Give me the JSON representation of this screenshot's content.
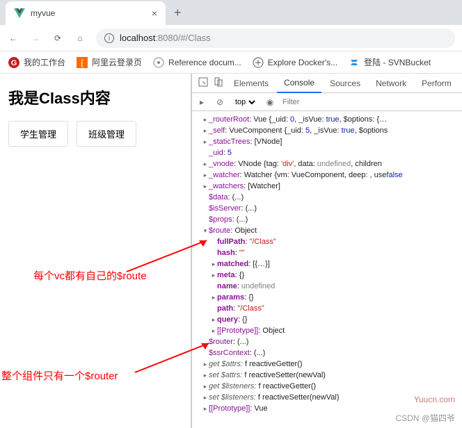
{
  "browser": {
    "tab_title": "myvue",
    "url_host": "localhost",
    "url_port_path": ":8080/#/Class",
    "bookmarks": [
      {
        "icon": "gitee",
        "label": "我的工作台"
      },
      {
        "icon": "aliyun",
        "label": "阿里云登录页"
      },
      {
        "icon": "doc",
        "label": "Reference docum..."
      },
      {
        "icon": "docker",
        "label": "Explore Docker's..."
      },
      {
        "icon": "svn",
        "label": "登陆 - SVNBucket"
      }
    ]
  },
  "page": {
    "heading": "我是Class内容",
    "btn_student": "学生管理",
    "btn_class": "班级管理"
  },
  "annotations": {
    "anno1": "每个vc都有自己的$route",
    "anno2": "整个组件只有一个$router"
  },
  "devtools": {
    "tabs": [
      "Elements",
      "Console",
      "Sources",
      "Network",
      "Perform"
    ],
    "active_tab": "Console",
    "scope": "top",
    "filter_placeholder": "Filter"
  },
  "console": {
    "lines": [
      {
        "i": 1,
        "a": "r",
        "k": "_routerRoot",
        "v": ": Vue {_uid: ",
        "n0": "0",
        "v2": ", _isVue: ",
        "b": "true",
        "v3": ", $options: {…"
      },
      {
        "i": 1,
        "a": "r",
        "k": "_self",
        "v": ": VueComponent {_uid: ",
        "n0": "5",
        "v2": ", _isVue: ",
        "b": "true",
        "v3": ", $options"
      },
      {
        "i": 1,
        "a": "r",
        "k": "_staticTrees",
        "v": ": [VNode]"
      },
      {
        "i": 1,
        "a": "",
        "k": "_uid",
        "v": ": ",
        "n0": "5"
      },
      {
        "i": 1,
        "a": "r",
        "k": "_vnode",
        "v": ": VNode {tag: ",
        "s": "'div'",
        "v2": ", data: ",
        "u": "undefined",
        "v3": ", children"
      },
      {
        "i": 1,
        "a": "r",
        "k": "_watcher",
        "v": ": Watcher {vm: VueComponent, deep: ",
        "b": "false",
        "v2": ", use"
      },
      {
        "i": 1,
        "a": "r",
        "k": "_watchers",
        "v": ": [Watcher]"
      },
      {
        "i": 1,
        "a": "",
        "k": "$data",
        "v": ": (...)"
      },
      {
        "i": 1,
        "a": "",
        "k": "$isServer",
        "v": ": (...)"
      },
      {
        "i": 1,
        "a": "",
        "k": "$props",
        "v": ": (...)"
      },
      {
        "i": 1,
        "a": "d",
        "k": "$route",
        "v": ": Object"
      },
      {
        "i": 2,
        "a": "",
        "kb": "fullPath",
        "v": ": ",
        "s": "\"/Class\""
      },
      {
        "i": 2,
        "a": "",
        "kb": "hash",
        "v": ": ",
        "s": "\"\""
      },
      {
        "i": 2,
        "a": "r",
        "kb": "matched",
        "v": ": [{…}]"
      },
      {
        "i": 2,
        "a": "r",
        "kb": "meta",
        "v": ": {}"
      },
      {
        "i": 2,
        "a": "",
        "kb": "name",
        "v": ": ",
        "u": "undefined"
      },
      {
        "i": 2,
        "a": "r",
        "kb": "params",
        "v": ": {}"
      },
      {
        "i": 2,
        "a": "",
        "kb": "path",
        "v": ": ",
        "s": "\"/Class\""
      },
      {
        "i": 2,
        "a": "r",
        "kb": "query",
        "v": ": {}"
      },
      {
        "i": 2,
        "a": "r",
        "k": "[[Prototype]]",
        "v": ": Object"
      },
      {
        "i": 1,
        "a": "",
        "k": "$router",
        "v": ": (...)"
      },
      {
        "i": 1,
        "a": "",
        "k": "$ssrContext",
        "v": ": (...)"
      },
      {
        "i": 1,
        "a": "r",
        "gi": "get $attrs: ",
        "fn": "f reactiveGetter()"
      },
      {
        "i": 1,
        "a": "r",
        "gi": "set $attrs: ",
        "fn": "f reactiveSetter(newVal)"
      },
      {
        "i": 1,
        "a": "r",
        "gi": "get $listeners: ",
        "fn": "f reactiveGetter()"
      },
      {
        "i": 1,
        "a": "r",
        "gi": "set $listeners: ",
        "fn": "f reactiveSetter(newVal)"
      },
      {
        "i": 1,
        "a": "r",
        "k": "[[Prototype]]",
        "v": ": Vue"
      }
    ]
  },
  "watermarks": {
    "w1": "Yuucn.com",
    "w2": "CSDN @猫四爷"
  }
}
